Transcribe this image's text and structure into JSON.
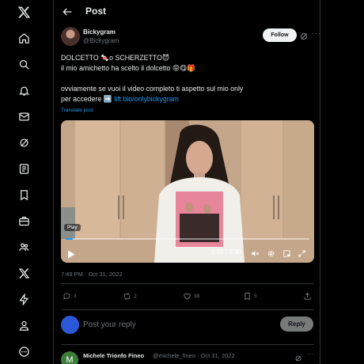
{
  "nav": {
    "items": [
      "x-logo-icon",
      "home-icon",
      "search-icon",
      "notifications-icon",
      "messages-icon",
      "grok-icon",
      "lists-icon",
      "bookmarks-icon",
      "jobs-icon",
      "communities-icon",
      "premium-icon",
      "verified-orgs-icon",
      "profile-icon",
      "more-icon"
    ]
  },
  "header": {
    "title": "Post"
  },
  "post": {
    "author_name": "Bickygram",
    "author_handle": "@Bickygram",
    "follow_label": "Follow",
    "line1": "DOLCETTO 🍬o SCHERZETTO😈",
    "line2": "il mio amichetto ha scelto il dolcetto 😝😋🎁",
    "line3": "ovviamente se vuoi il video completo ti aspetto sul mio only",
    "line4_prefix": "per accedere ➡️ ",
    "link": "lift.bio/onlybickygram",
    "translate": "Translate post",
    "video": {
      "badge": "Play",
      "timecode": "0:01 / 0:30",
      "progress": 0.03
    },
    "timestamp": "7:49 PM · Oct 31, 2022",
    "stats": {
      "replies": "3",
      "reposts": "2",
      "likes": "38",
      "bookmarks": "5"
    }
  },
  "reply_box": {
    "placeholder": "Post your reply",
    "button": "Reply"
  },
  "comment": {
    "avatar_letter": "M",
    "name": "Michele Trionfo Fineo",
    "handle_date": "@michele_fineo · Oct 31, 2022"
  },
  "colors": {
    "accent": "#1d9bf0",
    "border": "#2f3336",
    "muted": "#71767b"
  }
}
